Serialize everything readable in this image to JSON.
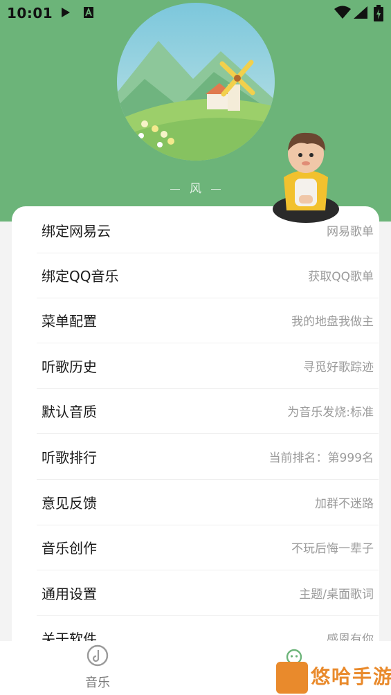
{
  "status_bar": {
    "time": "10:01"
  },
  "header": {
    "scene_label": "风"
  },
  "menu": [
    {
      "title": "绑定网易云",
      "subtitle": "网易歌单"
    },
    {
      "title": "绑定QQ音乐",
      "subtitle": "获取QQ歌单"
    },
    {
      "title": "菜单配置",
      "subtitle": "我的地盘我做主"
    },
    {
      "title": "听歌历史",
      "subtitle": "寻觅好歌踪迹"
    },
    {
      "title": "默认音质",
      "subtitle": "为音乐发烧:标准"
    },
    {
      "title": "听歌排行",
      "subtitle": "当前排名：第999名"
    },
    {
      "title": "意见反馈",
      "subtitle": "加群不迷路"
    },
    {
      "title": "音乐创作",
      "subtitle": "不玩后悔一辈子"
    },
    {
      "title": "通用设置",
      "subtitle": "主题/桌面歌词"
    },
    {
      "title": "关于软件",
      "subtitle": "感恩有你"
    }
  ],
  "bottom_nav": {
    "music_label": "音乐"
  },
  "watermark": {
    "text": "悠哈手游"
  },
  "colors": {
    "header_bg": "#6cb479",
    "watermark": "#e98a2c"
  }
}
